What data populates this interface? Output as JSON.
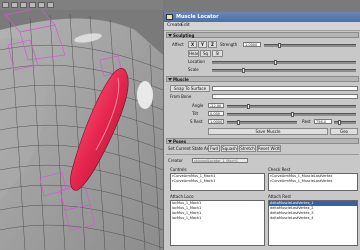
{
  "window": {
    "title": "Muscle Locator",
    "menu": [
      "Create",
      "Edit"
    ]
  },
  "sculpting": {
    "header": "Sculpting",
    "affect_label": "Affect",
    "axis_options": [
      "X",
      "Y",
      "Z"
    ],
    "strength_label": "Strength",
    "strength_value": "1.0000",
    "mode_buttons": [
      "Head",
      "Sq",
      "Sl"
    ],
    "row1_label": "Location",
    "row2_label": "Scale"
  },
  "muscle": {
    "header": "Muscle",
    "snap_button": "Snap To Surface",
    "from_bone_label": "From Bone",
    "angle_label": "Angle",
    "angle_value": "-22.00",
    "tilt_label": "Tilt",
    "tilt_value": "0.000",
    "s_rest_label": "S Rest",
    "s_rest_value": "1.0000",
    "rest_label": "Rest",
    "rest_value": "756.0",
    "save_muscle_button": "Save Muscle",
    "extra_button": "Geo"
  },
  "poses": {
    "header": "Poses",
    "set_state_label": "Set Current State As",
    "state_buttons": [
      "Fwd",
      "Squash",
      "Stretch",
      "Reset Width"
    ],
    "creator_label": "Creator",
    "creator_value": "skinnedLocator_1_Mach1",
    "controls_header": "Controls",
    "controls_items": [
      "rCurveArmMus_1_Mach1",
      "rCurveArmMus_1_Mach1"
    ],
    "check_rest_header": "Check Rest",
    "check_rest_items": [
      "rCurveArmMus_1_MuscleLastVertex",
      "rCurveArmMus_1_MuscleLastVertex"
    ],
    "attach_loco_header": "Attach Loco",
    "attach_loco_items": [
      "locMus_1_Mach1",
      "locMus_1_Mach1",
      "locMus_1_Mach1",
      "locMus_1_Mach1"
    ],
    "attach_rest_header": "Attach Rest",
    "attach_rest_items": [
      "deltaMuscleLastVertex_1",
      "deltaMuscleLastVertex_2",
      "deltaMuscleLastVertex_3",
      "deltaMuscleLastVertex_4"
    ]
  },
  "viewport": {
    "background": "#7a7a7a",
    "muscle_color": "#e6264e",
    "locator_color": "#d25ad2"
  }
}
